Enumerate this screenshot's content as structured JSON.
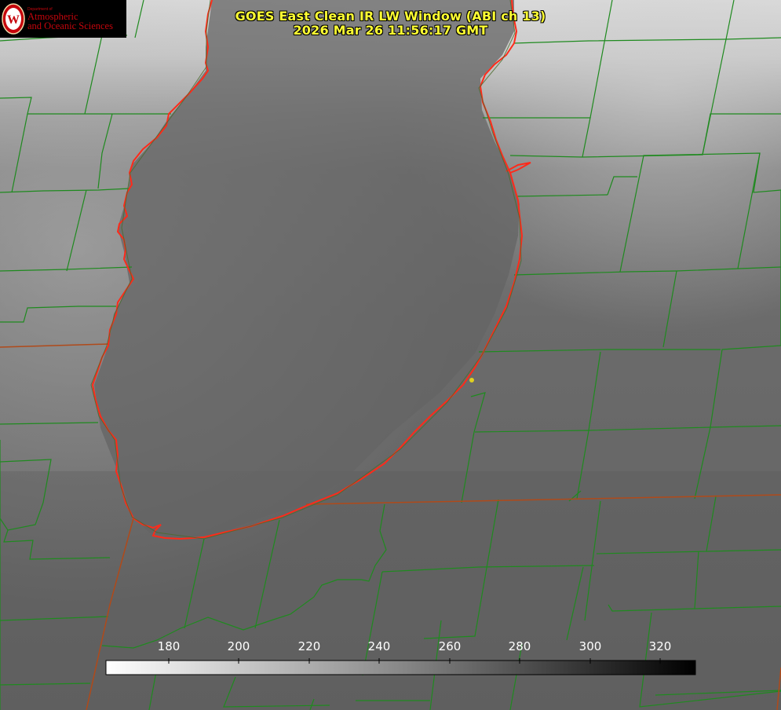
{
  "title": {
    "line1": "GOES East Clean IR LW Window (ABI ch 13)",
    "line2": "2026 Mar 26 11:56:17 GMT"
  },
  "logo": {
    "department": "Department of",
    "line1": "Atmospheric",
    "line2": "and Oceanic Sciences",
    "seal_letter": "W"
  },
  "colorbar": {
    "ticks": [
      "180",
      "200",
      "220",
      "240",
      "260",
      "280",
      "300",
      "320"
    ]
  },
  "colors": {
    "title_text": "#ffff33",
    "coastline": "#ff2a1a",
    "county_lines": "#1f8a1f",
    "state_lines": "#b04a1a",
    "marker": "#e0d020",
    "logo_red": "#c5050c"
  }
}
